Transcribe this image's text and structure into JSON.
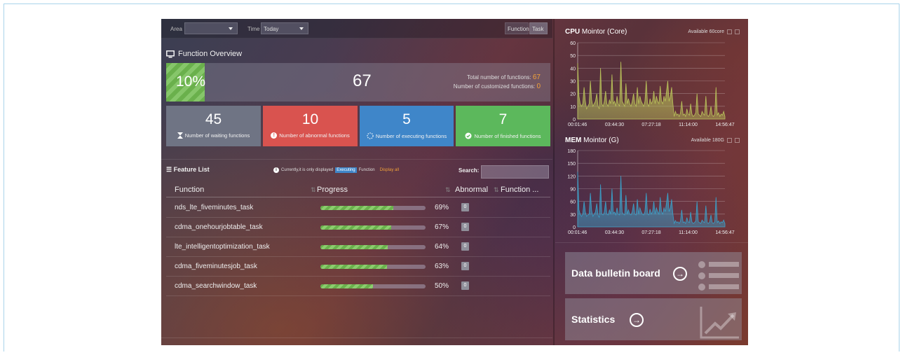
{
  "filters": {
    "area_label": "Area",
    "area_value": "",
    "time_label": "Time",
    "time_value": "Today",
    "function_label": "Function",
    "task_label": "Task"
  },
  "overview": {
    "title": "Function Overview",
    "percent": "10%",
    "percent_value": 10,
    "total": "67",
    "total_label": "Total number of functions:",
    "total_value": "67",
    "customized_label": "Number of customized functions:",
    "customized_value": "0",
    "cards": [
      {
        "num": "45",
        "label": "Number of waiting functions",
        "icon": "hourglass-icon",
        "color": "#6f7484"
      },
      {
        "num": "10",
        "label": "Number of abnormal functions",
        "icon": "exclamation-icon",
        "color": "#d9534f"
      },
      {
        "num": "5",
        "label": "Number of executing functions",
        "icon": "spinner-icon",
        "color": "#3f86c9"
      },
      {
        "num": "7",
        "label": "Number of finished functions",
        "icon": "check-circle-icon",
        "color": "#5cb85c"
      }
    ]
  },
  "feature_list": {
    "title": "Feature List",
    "note_prefix": "Currently,it is only displayed",
    "note_tag": "Executing",
    "note_suffix": "Function",
    "display_all": "Display all",
    "search_label": "Search:",
    "search_value": "",
    "columns": [
      "Function",
      "Progress",
      "Abnormal",
      "Function ..."
    ],
    "rows": [
      {
        "name": "nds_lte_fiveminutes_task",
        "progress": 69,
        "progress_text": "69%",
        "abnormal": "0"
      },
      {
        "name": "cdma_onehourjobtable_task",
        "progress": 67,
        "progress_text": "67%",
        "abnormal": "0"
      },
      {
        "name": "lte_intelligentoptimization_task",
        "progress": 64,
        "progress_text": "64%",
        "abnormal": "0"
      },
      {
        "name": "cdma_fiveminutesjob_task",
        "progress": 63,
        "progress_text": "63%",
        "abnormal": "0"
      },
      {
        "name": "cdma_searchwindow_task",
        "progress": 50,
        "progress_text": "50%",
        "abnormal": "0"
      }
    ]
  },
  "cpu": {
    "title_bold": "CPU",
    "title_rest": "Mointor (Core)",
    "available": "Available 60core",
    "color": "#b9c25a"
  },
  "mem": {
    "title_bold": "MEM",
    "title_rest": "Mointor (G)",
    "available": "Available 180G",
    "color": "#3aa0c8"
  },
  "tiles": {
    "bulletin": "Data bulletin board",
    "statistics": "Statistics",
    "bulletin_icon": "list-icon",
    "statistics_icon": "trend-chart-icon"
  },
  "chart_data": [
    {
      "type": "area",
      "title": "CPU Mointor (Core)",
      "x_ticks": [
        "00:01:46",
        "03:44:30",
        "07:27:18",
        "11:14:00",
        "14:56:47"
      ],
      "y_ticks": [
        0,
        10,
        20,
        30,
        40,
        50,
        60
      ],
      "ylim": [
        0,
        60
      ],
      "grid": true,
      "series": [
        {
          "values": [
            44,
            18,
            12,
            10,
            12,
            25,
            14,
            8,
            10,
            12,
            30,
            15,
            10,
            12,
            14,
            20,
            10,
            8,
            40,
            12,
            10,
            14,
            22,
            12,
            10,
            15,
            12,
            35,
            12,
            14,
            10,
            18,
            12,
            10,
            45,
            14,
            12,
            10,
            28,
            12,
            16,
            12,
            10,
            14,
            20,
            12,
            10,
            25,
            12,
            18,
            14,
            12,
            10,
            14,
            30,
            12,
            10,
            16,
            12,
            14,
            22,
            12,
            18,
            14,
            12,
            26,
            14,
            12,
            18,
            14,
            22,
            30,
            14,
            18,
            25,
            12,
            2,
            6,
            3,
            4,
            2,
            5,
            14,
            3,
            4,
            2,
            8,
            4,
            3,
            12,
            4,
            2,
            3,
            5,
            20,
            4,
            3,
            2,
            6,
            4,
            3,
            18,
            3,
            2,
            4,
            10,
            3,
            2,
            4,
            25,
            3,
            5,
            2,
            4,
            3,
            6,
            2
          ]
        }
      ]
    },
    {
      "type": "area",
      "title": "MEM Mointor (G)",
      "x_ticks": [
        "00:01:46",
        "03:44:30",
        "07:27:18",
        "11:14:00",
        "14:56:47"
      ],
      "y_ticks": [
        0,
        30,
        60,
        90,
        120,
        150,
        180
      ],
      "ylim": [
        0,
        180
      ],
      "grid": true,
      "series": [
        {
          "values": [
            130,
            40,
            30,
            25,
            30,
            60,
            35,
            25,
            28,
            30,
            80,
            38,
            25,
            30,
            35,
            55,
            28,
            22,
            100,
            30,
            28,
            35,
            60,
            30,
            28,
            40,
            30,
            90,
            32,
            35,
            28,
            45,
            30,
            28,
            120,
            35,
            30,
            28,
            75,
            30,
            40,
            30,
            28,
            36,
            55,
            30,
            28,
            65,
            30,
            45,
            36,
            30,
            28,
            36,
            80,
            30,
            28,
            42,
            30,
            36,
            60,
            30,
            45,
            36,
            30,
            70,
            36,
            30,
            45,
            36,
            58,
            80,
            36,
            45,
            65,
            30,
            8,
            15,
            10,
            12,
            8,
            14,
            40,
            10,
            12,
            8,
            22,
            12,
            10,
            35,
            12,
            8,
            10,
            14,
            60,
            12,
            10,
            8,
            16,
            12,
            10,
            50,
            10,
            8,
            12,
            28,
            10,
            8,
            12,
            70,
            10,
            14,
            8,
            12,
            10,
            16,
            8
          ]
        }
      ]
    }
  ]
}
